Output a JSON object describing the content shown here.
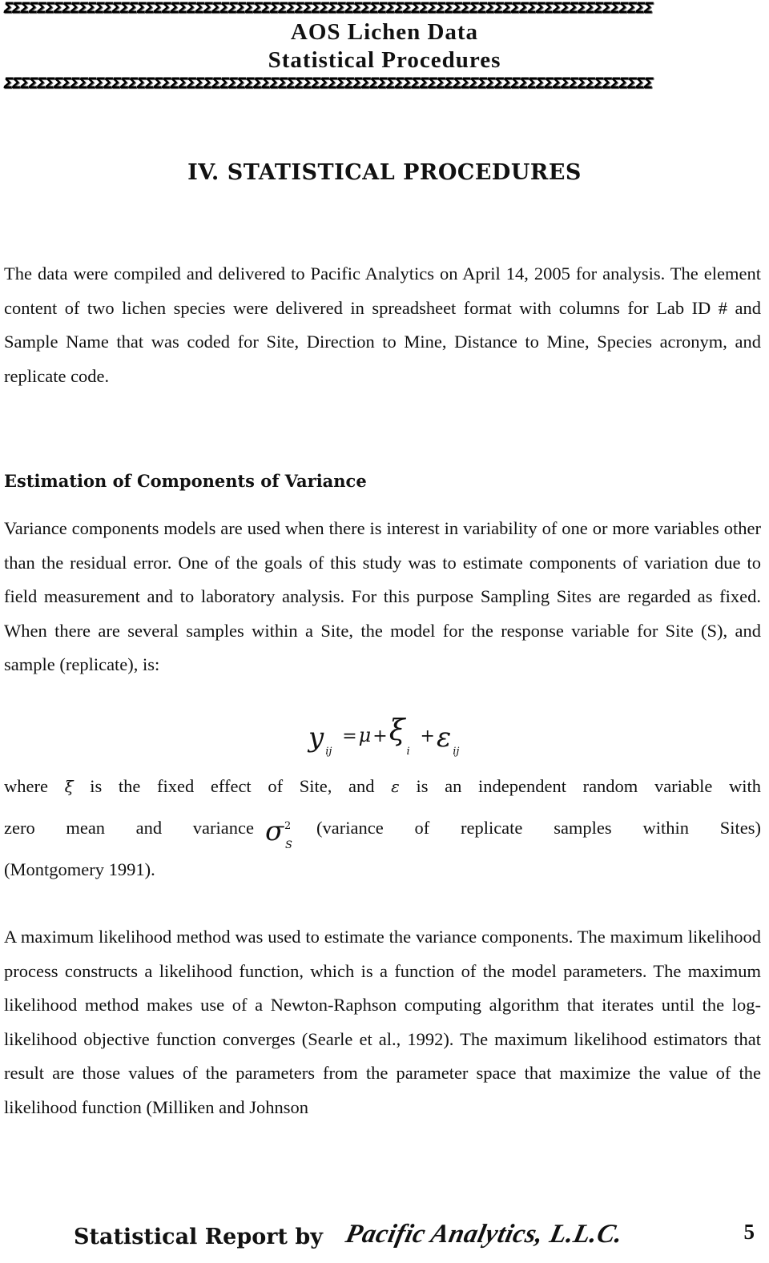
{
  "header": {
    "border_glyphs": "ΣΣΣΣΣΣΣΣΣΣΣΣΣΣΣΣΣΣΣΣΣΣΣΣΣΣΣΣΣΣΣΣΣΣΣΣΣΣΣΣΣΣΣΣΣΣΣΣΣΣΣΣΣΣΣΣΣΣΣΣΣΣΣΣΣΣΣΣΣΣΣΣΣΣΣΣΣΣ",
    "title_line_1": "AOS Lichen Data",
    "title_line_2": "Statistical Procedures"
  },
  "section": {
    "heading": "IV. STATISTICAL PROCEDURES",
    "intro_paragraph": "The data were compiled and delivered to Pacific Analytics on April 14, 2005 for analysis. The element content of two lichen species were delivered in spreadsheet format with columns for Lab ID # and Sample Name that was coded for Site, Direction to Mine, Distance to Mine, Species acronym, and replicate code."
  },
  "subsection": {
    "heading": "Estimation of Components of Variance",
    "paragraph_1": "Variance components models are used when there is interest in variability of one or more variables other than the residual error. One of the goals of this study was to estimate components of variation due to field measurement and to laboratory analysis. For this purpose Sampling Sites are regarded as fixed. When there are several samples within a Site, the model for the response variable for Site (S), and sample (replicate), is:",
    "equation": {
      "lhs": "y",
      "lhs_sub": "ij",
      "equals": "=",
      "mu": "μ",
      "plus_1": "+",
      "xi": "ξ",
      "xi_sub": "i",
      "plus_2": "+",
      "epsilon": "ε",
      "epsilon_sub": "ij"
    },
    "where_line": {
      "part_1": "where",
      "xi": "ξ",
      "part_2": "is the fixed effect of Site, and",
      "epsilon": "ε",
      "part_3": "is an independent random variable with"
    },
    "variance_line": {
      "words_left": [
        "zero",
        "mean",
        "and",
        "variance"
      ],
      "sigma": "σ",
      "sigma_sup": "2",
      "sigma_sub": "S",
      "words_right": [
        "(variance",
        "of",
        "replicate",
        "samples",
        "within",
        "Sites)"
      ]
    },
    "citation_line": "(Montgomery 1991).",
    "paragraph_2": "A maximum likelihood method was used to estimate the variance components. The maximum likelihood process constructs a likelihood function, which is a function of the model parameters. The maximum likelihood method makes use of a Newton-Raphson computing algorithm that iterates until the log-likelihood objective function converges (Searle et al., 1992). The maximum likelihood estimators that result are those values of the parameters from the parameter space that maximize the value of the likelihood function (Milliken and Johnson"
  },
  "footer": {
    "label": "Statistical Report by",
    "company": "Pacific Analytics, L.L.C.",
    "page_number": "5"
  }
}
